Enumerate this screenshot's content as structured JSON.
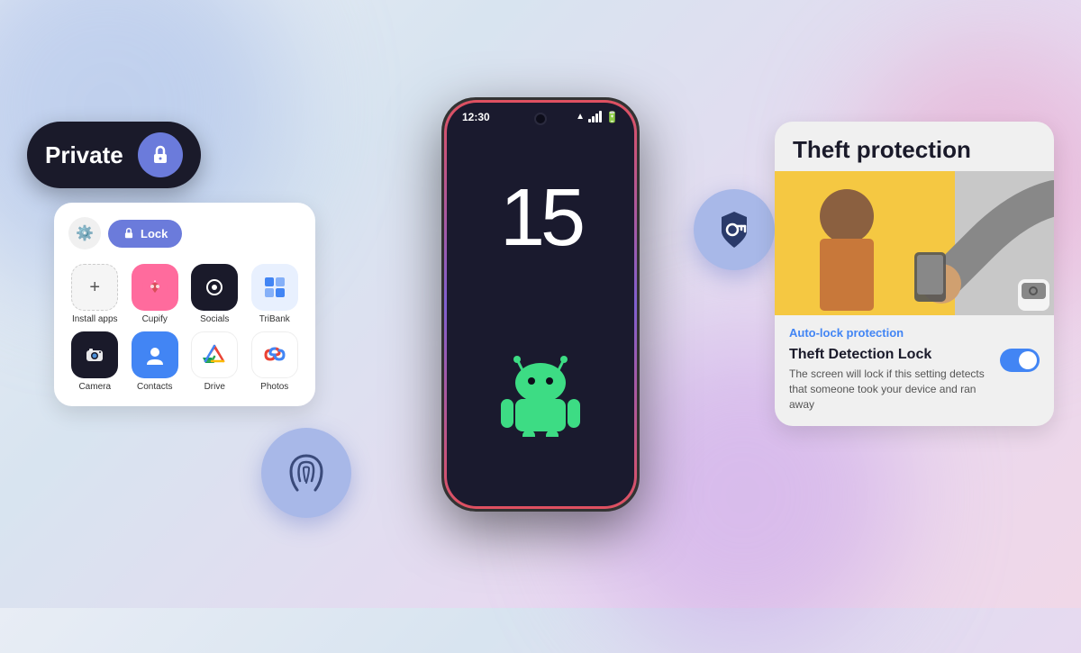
{
  "background": {
    "gradient": "linear-gradient(135deg, #e8edf5, #d8e4f0, #e8d8f0, #f0d8e8)"
  },
  "private_pill": {
    "label": "Private",
    "icon": "lock-icon"
  },
  "app_grid": {
    "gear_label": "⚙",
    "lock_button_label": "Lock",
    "apps": [
      {
        "name": "Install apps",
        "icon": "+",
        "bg": "install"
      },
      {
        "name": "Cupify",
        "icon": "♥",
        "bg": "cupify"
      },
      {
        "name": "Socials",
        "icon": "◉",
        "bg": "socials"
      },
      {
        "name": "TriBank",
        "icon": "₿",
        "bg": "tribank"
      },
      {
        "name": "Camera",
        "icon": "📷",
        "bg": "camera"
      },
      {
        "name": "Contacts",
        "icon": "👤",
        "bg": "contacts"
      },
      {
        "name": "Drive",
        "icon": "△",
        "bg": "drive"
      },
      {
        "name": "Photos",
        "icon": "✿",
        "bg": "photos"
      }
    ]
  },
  "phone": {
    "time": "12:30",
    "number": "15"
  },
  "theft_protection": {
    "title": "Theft protection",
    "auto_lock_label": "Auto-lock protection",
    "feature_title": "Theft Detection Lock",
    "feature_desc": "The screen will lock if this setting detects that someone took your device and ran away",
    "toggle_state": "on"
  },
  "fingerprint_bubble": {
    "icon": "fingerprint-icon"
  },
  "shield_bubble": {
    "icon": "shield-key-icon"
  }
}
